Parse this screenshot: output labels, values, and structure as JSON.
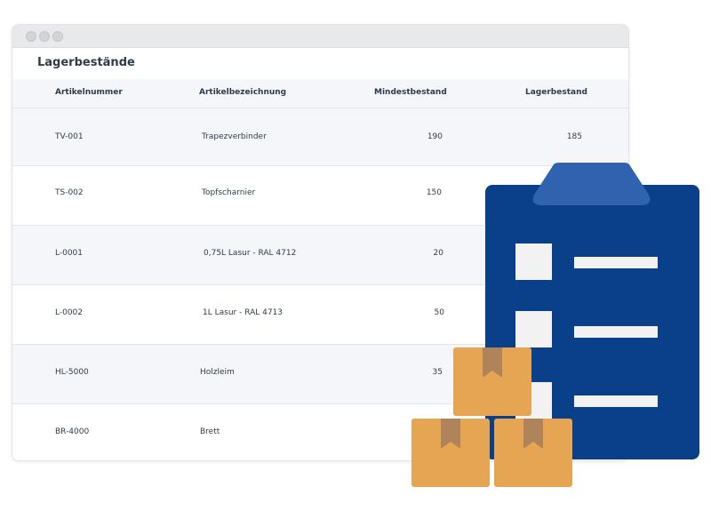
{
  "window": {
    "title": "Lagerbestände"
  },
  "table": {
    "columns": [
      "Artikelnummer",
      "Artikelbezeichnung",
      "Mindestbestand",
      "Lagerbestand"
    ],
    "rows": [
      {
        "nr": "TV-001",
        "name": "Trapezverbinder",
        "min": "190",
        "stock": "185"
      },
      {
        "nr": "TS-002",
        "name": "Topfscharnier",
        "min": "150",
        "stock": ""
      },
      {
        "nr": "L-0001",
        "name": "0,75L Lasur - RAL 4712",
        "min": "20",
        "stock": ""
      },
      {
        "nr": "L-0002",
        "name": "1L Lasur - RAL 4713",
        "min": "50",
        "stock": ""
      },
      {
        "nr": "HL-5000",
        "name": "Holzleim",
        "min": "35",
        "stock": ""
      },
      {
        "nr": "BR-4000",
        "name": "Brett",
        "min": "",
        "stock": ""
      }
    ]
  },
  "colors": {
    "clipboard": "#0a3f8a",
    "clipboard_head": "#2f63b0",
    "box": "#e6a552",
    "box_tape": "#b0845a",
    "row_alt": "#f5f6f9"
  },
  "icons": [
    "clipboard-icon",
    "box-icon"
  ]
}
